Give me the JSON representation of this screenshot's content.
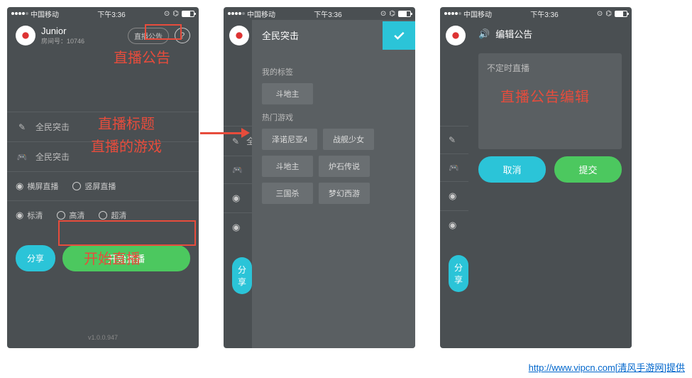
{
  "status": {
    "carrier": "中国移动",
    "time": "下午3:36"
  },
  "screen1": {
    "user": {
      "name": "Junior",
      "id_label": "房间号：10746"
    },
    "announce_btn": "直播公告",
    "title_input": "全民突击",
    "game_input": "全民突击",
    "orientation": {
      "landscape": "横屏直播",
      "portrait": "竖屏直播"
    },
    "quality": {
      "sd": "标清",
      "hd": "高清",
      "uhd": "超清"
    },
    "share_btn": "分享",
    "start_btn": "开始直播",
    "version": "v1.0.0.947",
    "annotations": {
      "announce": "直播公告",
      "title": "直播标题",
      "game": "直播的游戏",
      "start": "开始直播"
    }
  },
  "screen2": {
    "selected": "全民突击",
    "my_tags_label": "我的标签",
    "my_tags": [
      "斗地主"
    ],
    "popular_label": "热门游戏",
    "popular": [
      "泽诺尼亚4",
      "战舰少女",
      "斗地主",
      "炉石传说",
      "三国杀",
      "梦幻西游"
    ]
  },
  "screen3": {
    "title": "编辑公告",
    "placeholder": "不定时直播",
    "cancel": "取消",
    "submit": "提交",
    "annotation": "直播公告编辑"
  },
  "footer": "http://www.vipcn.com[清风手游网]提供"
}
